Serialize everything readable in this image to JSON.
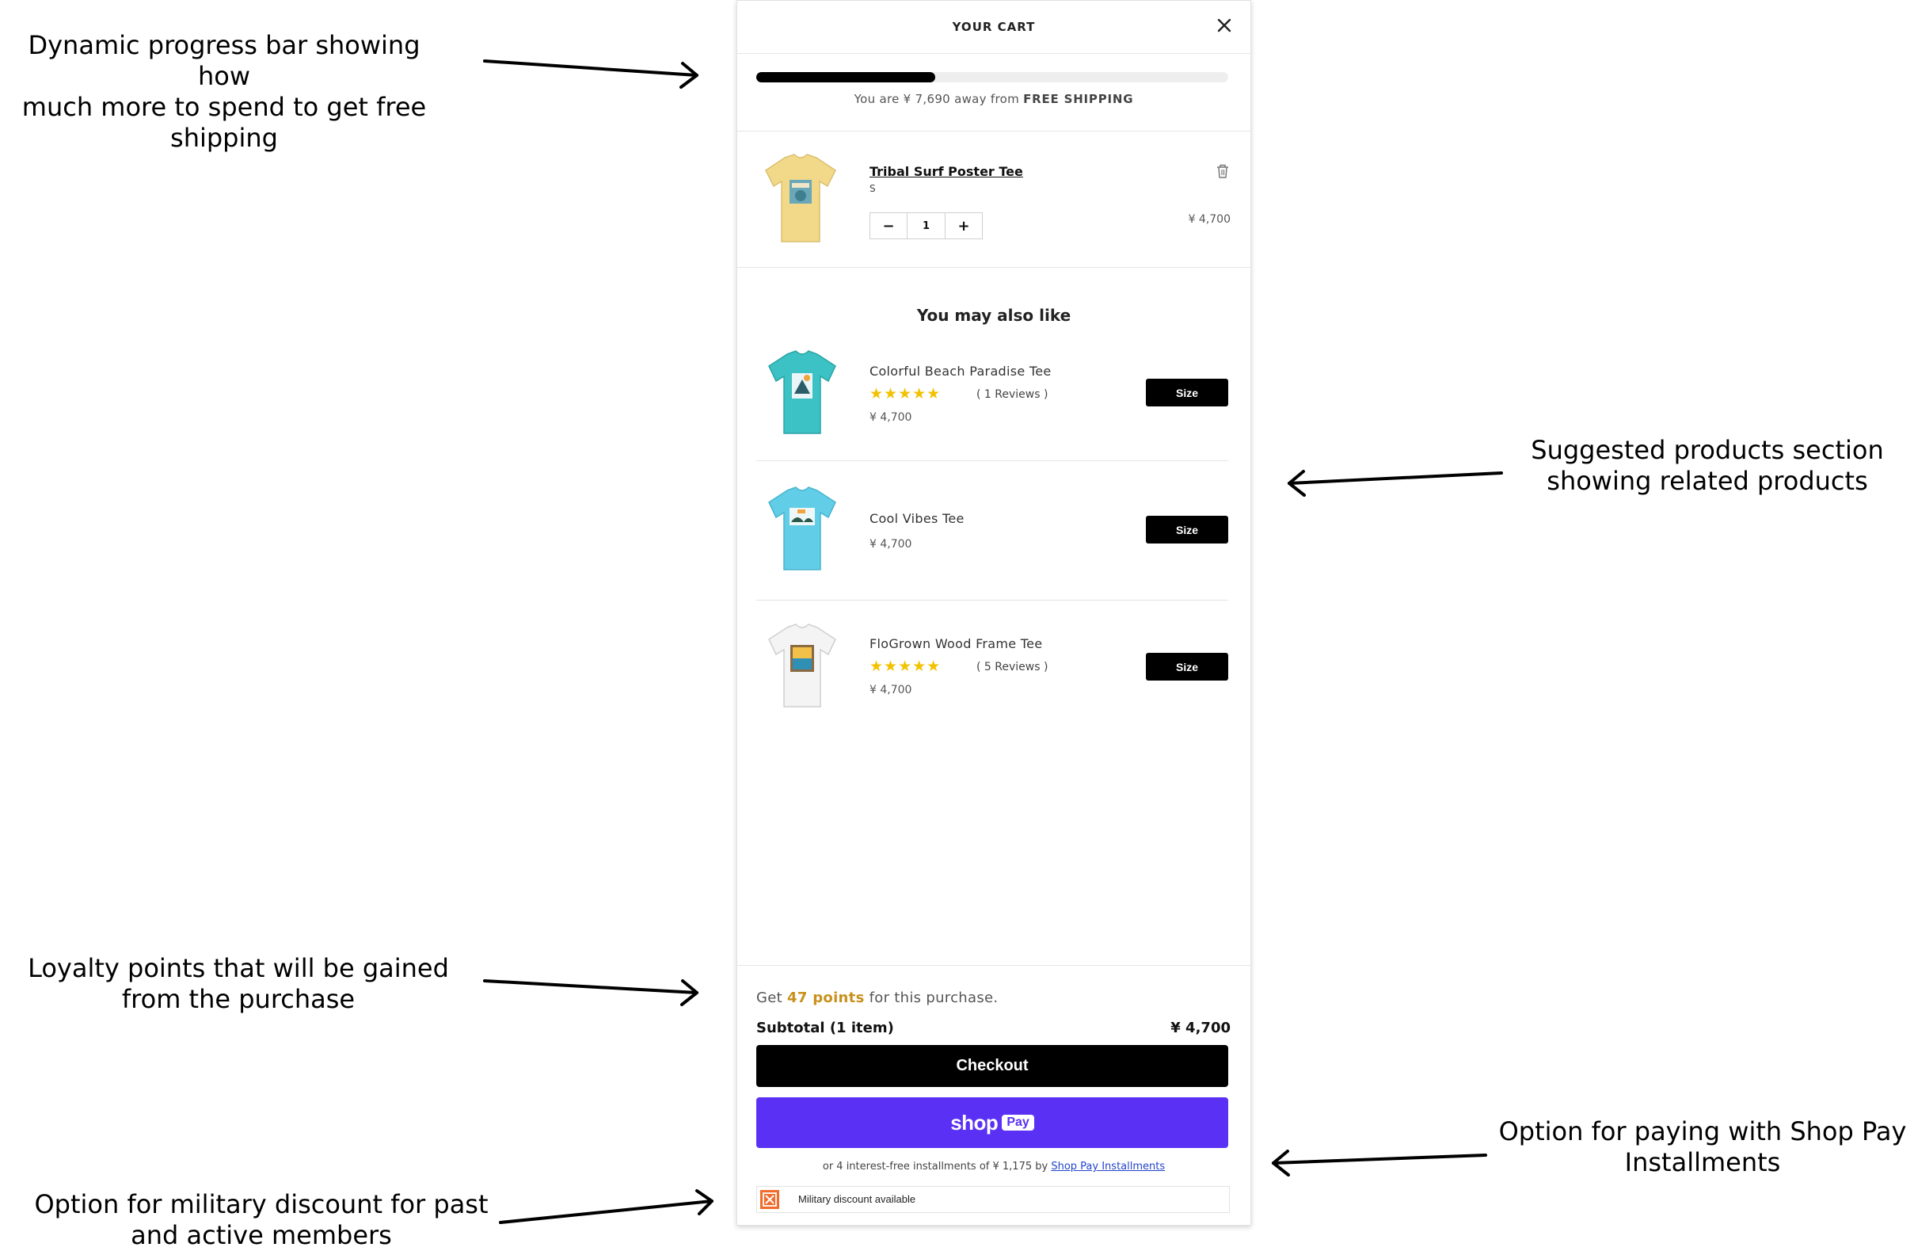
{
  "annotations": {
    "progress_bar": "Dynamic progress bar showing how\nmuch more to spend to get free\nshipping",
    "suggested": "Suggested products section\nshowing related products",
    "loyalty": "Loyalty points that will be gained\nfrom the purchase",
    "shop_pay": "Option for paying with Shop Pay\nInstallments",
    "military": "Option for military discount for past\nand active members"
  },
  "cart": {
    "title": "YOUR CART",
    "close_icon": "close-icon",
    "shipping": {
      "progress": 0.38,
      "text_prefix": "You are ¥ 7,690 away from",
      "text_bold": "FREE SHIPPING"
    },
    "item": {
      "name": "Tribal Surf Poster Tee",
      "variant": "S",
      "quantity": "1",
      "minus": "−",
      "plus": "+",
      "price": "¥ 4,700"
    },
    "suggestions": {
      "title": "You may also like",
      "items": [
        {
          "name": "Colorful Beach Paradise Tee",
          "stars": "★★★★★",
          "reviews": "( 1 Reviews )",
          "price": "¥ 4,700",
          "button": "Size",
          "color": "#3cc2c4"
        },
        {
          "name": "Cool Vibes Tee",
          "stars": "",
          "reviews": "",
          "price": "¥ 4,700",
          "button": "Size",
          "color": "#62cde6"
        },
        {
          "name": "FloGrown Wood Frame Tee",
          "stars": "★★★★★",
          "reviews": "( 5 Reviews )",
          "price": "¥ 4,700",
          "button": "Size",
          "color": "#f4f4f4"
        }
      ]
    },
    "footer": {
      "points_prefix": "Get",
      "points_value": "47 points",
      "points_suffix": "for this purchase.",
      "subtotal_label": "Subtotal (1 item)",
      "subtotal_value": "¥ 4,700",
      "checkout": "Checkout",
      "shop_pay_word": "shop",
      "shop_pay_badge": "Pay",
      "installments_text": "or 4 interest-free installments of ¥ 1,175 by",
      "installments_link": "Shop Pay Installments",
      "military": "Military discount available"
    }
  },
  "colors": {
    "accent_points": "#c8911c",
    "shop_pay": "#5a31f4",
    "star": "#f2c200",
    "item_tee": "#f2d98a"
  }
}
